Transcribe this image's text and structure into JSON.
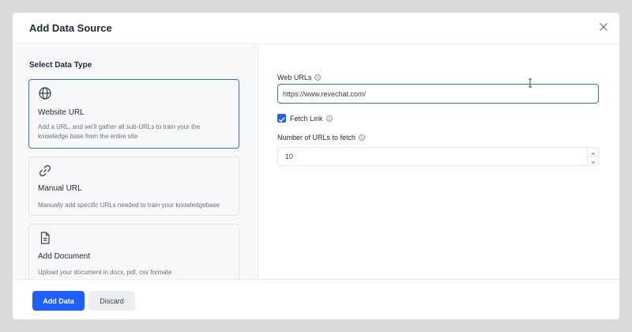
{
  "modal": {
    "title": "Add Data Source",
    "close_icon": "close-icon"
  },
  "left": {
    "section_title": "Select Data Type",
    "types": [
      {
        "icon": "globe-icon",
        "title": "Website URL",
        "description": "Add a URL, and we'll gather all sub-URLs to train your the knowledge base from the entire site",
        "selected": true
      },
      {
        "icon": "link-icon",
        "title": "Manual URL",
        "description": "Manually add specific URLs needed to train your knowledgebase",
        "selected": false
      },
      {
        "icon": "document-icon",
        "title": "Add Document",
        "description": "Upload your document in docx, pdf, csv formate",
        "selected": false
      }
    ]
  },
  "form": {
    "web_urls_label": "Web URLs",
    "web_urls_value": "https://www.revechat.com/",
    "fetch_link_label": "Fetch Link",
    "fetch_link_checked": true,
    "num_urls_label": "Number of URLs to fetch",
    "num_urls_value": "10"
  },
  "footer": {
    "primary_label": "Add Data",
    "secondary_label": "Discard"
  },
  "colors": {
    "accent": "#1f5eff",
    "selected_border": "#3b6fd4",
    "backdrop": "#d9d9d9"
  }
}
